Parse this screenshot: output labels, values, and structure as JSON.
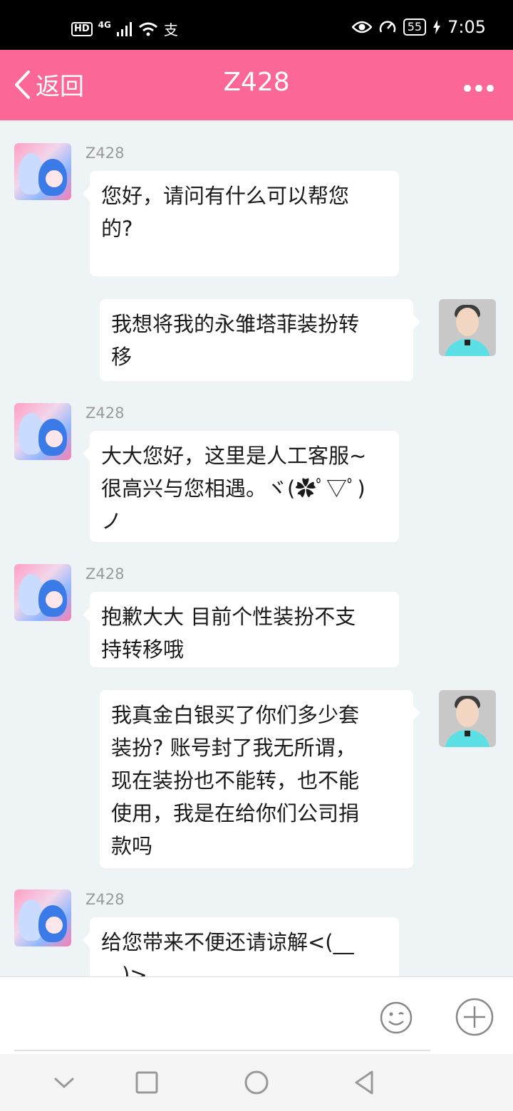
{
  "status_bar": {
    "hd": "HD",
    "network": "4G",
    "pay": "支",
    "battery": "55",
    "time": "7:05"
  },
  "header": {
    "back_label": "返回",
    "title": "Z428"
  },
  "messages": [
    {
      "side": "left",
      "sender": "Z428",
      "lines": [
        "您好，请问有什么可以帮您",
        "的?"
      ]
    },
    {
      "side": "right",
      "lines": [
        "我想将我的永雏塔菲装扮转",
        "移"
      ]
    },
    {
      "side": "left",
      "sender": "Z428",
      "lines": [
        "大大您好，这里是人工客服~",
        "很高兴与您相遇。ヾ(✿ﾟ▽ﾟ)",
        "ノ"
      ]
    },
    {
      "side": "left",
      "sender": "Z428",
      "lines": [
        "抱歉大大 目前个性装扮不支",
        "持转移哦"
      ]
    },
    {
      "side": "right",
      "lines": [
        "我真金白银买了你们多少套",
        "装扮? 账号封了我无所谓，",
        "现在装扮也不能转，也不能",
        "使用，我是在给你们公司捐",
        "款吗"
      ]
    },
    {
      "side": "left",
      "sender": "Z428",
      "lines": [
        "给您带来不便还请谅解<(__",
        "__)>"
      ]
    }
  ],
  "input": {
    "value": "",
    "placeholder": ""
  },
  "colors": {
    "header": "#fb6796",
    "chat_bg": "#eef4f5",
    "bubble": "#ffffff"
  }
}
